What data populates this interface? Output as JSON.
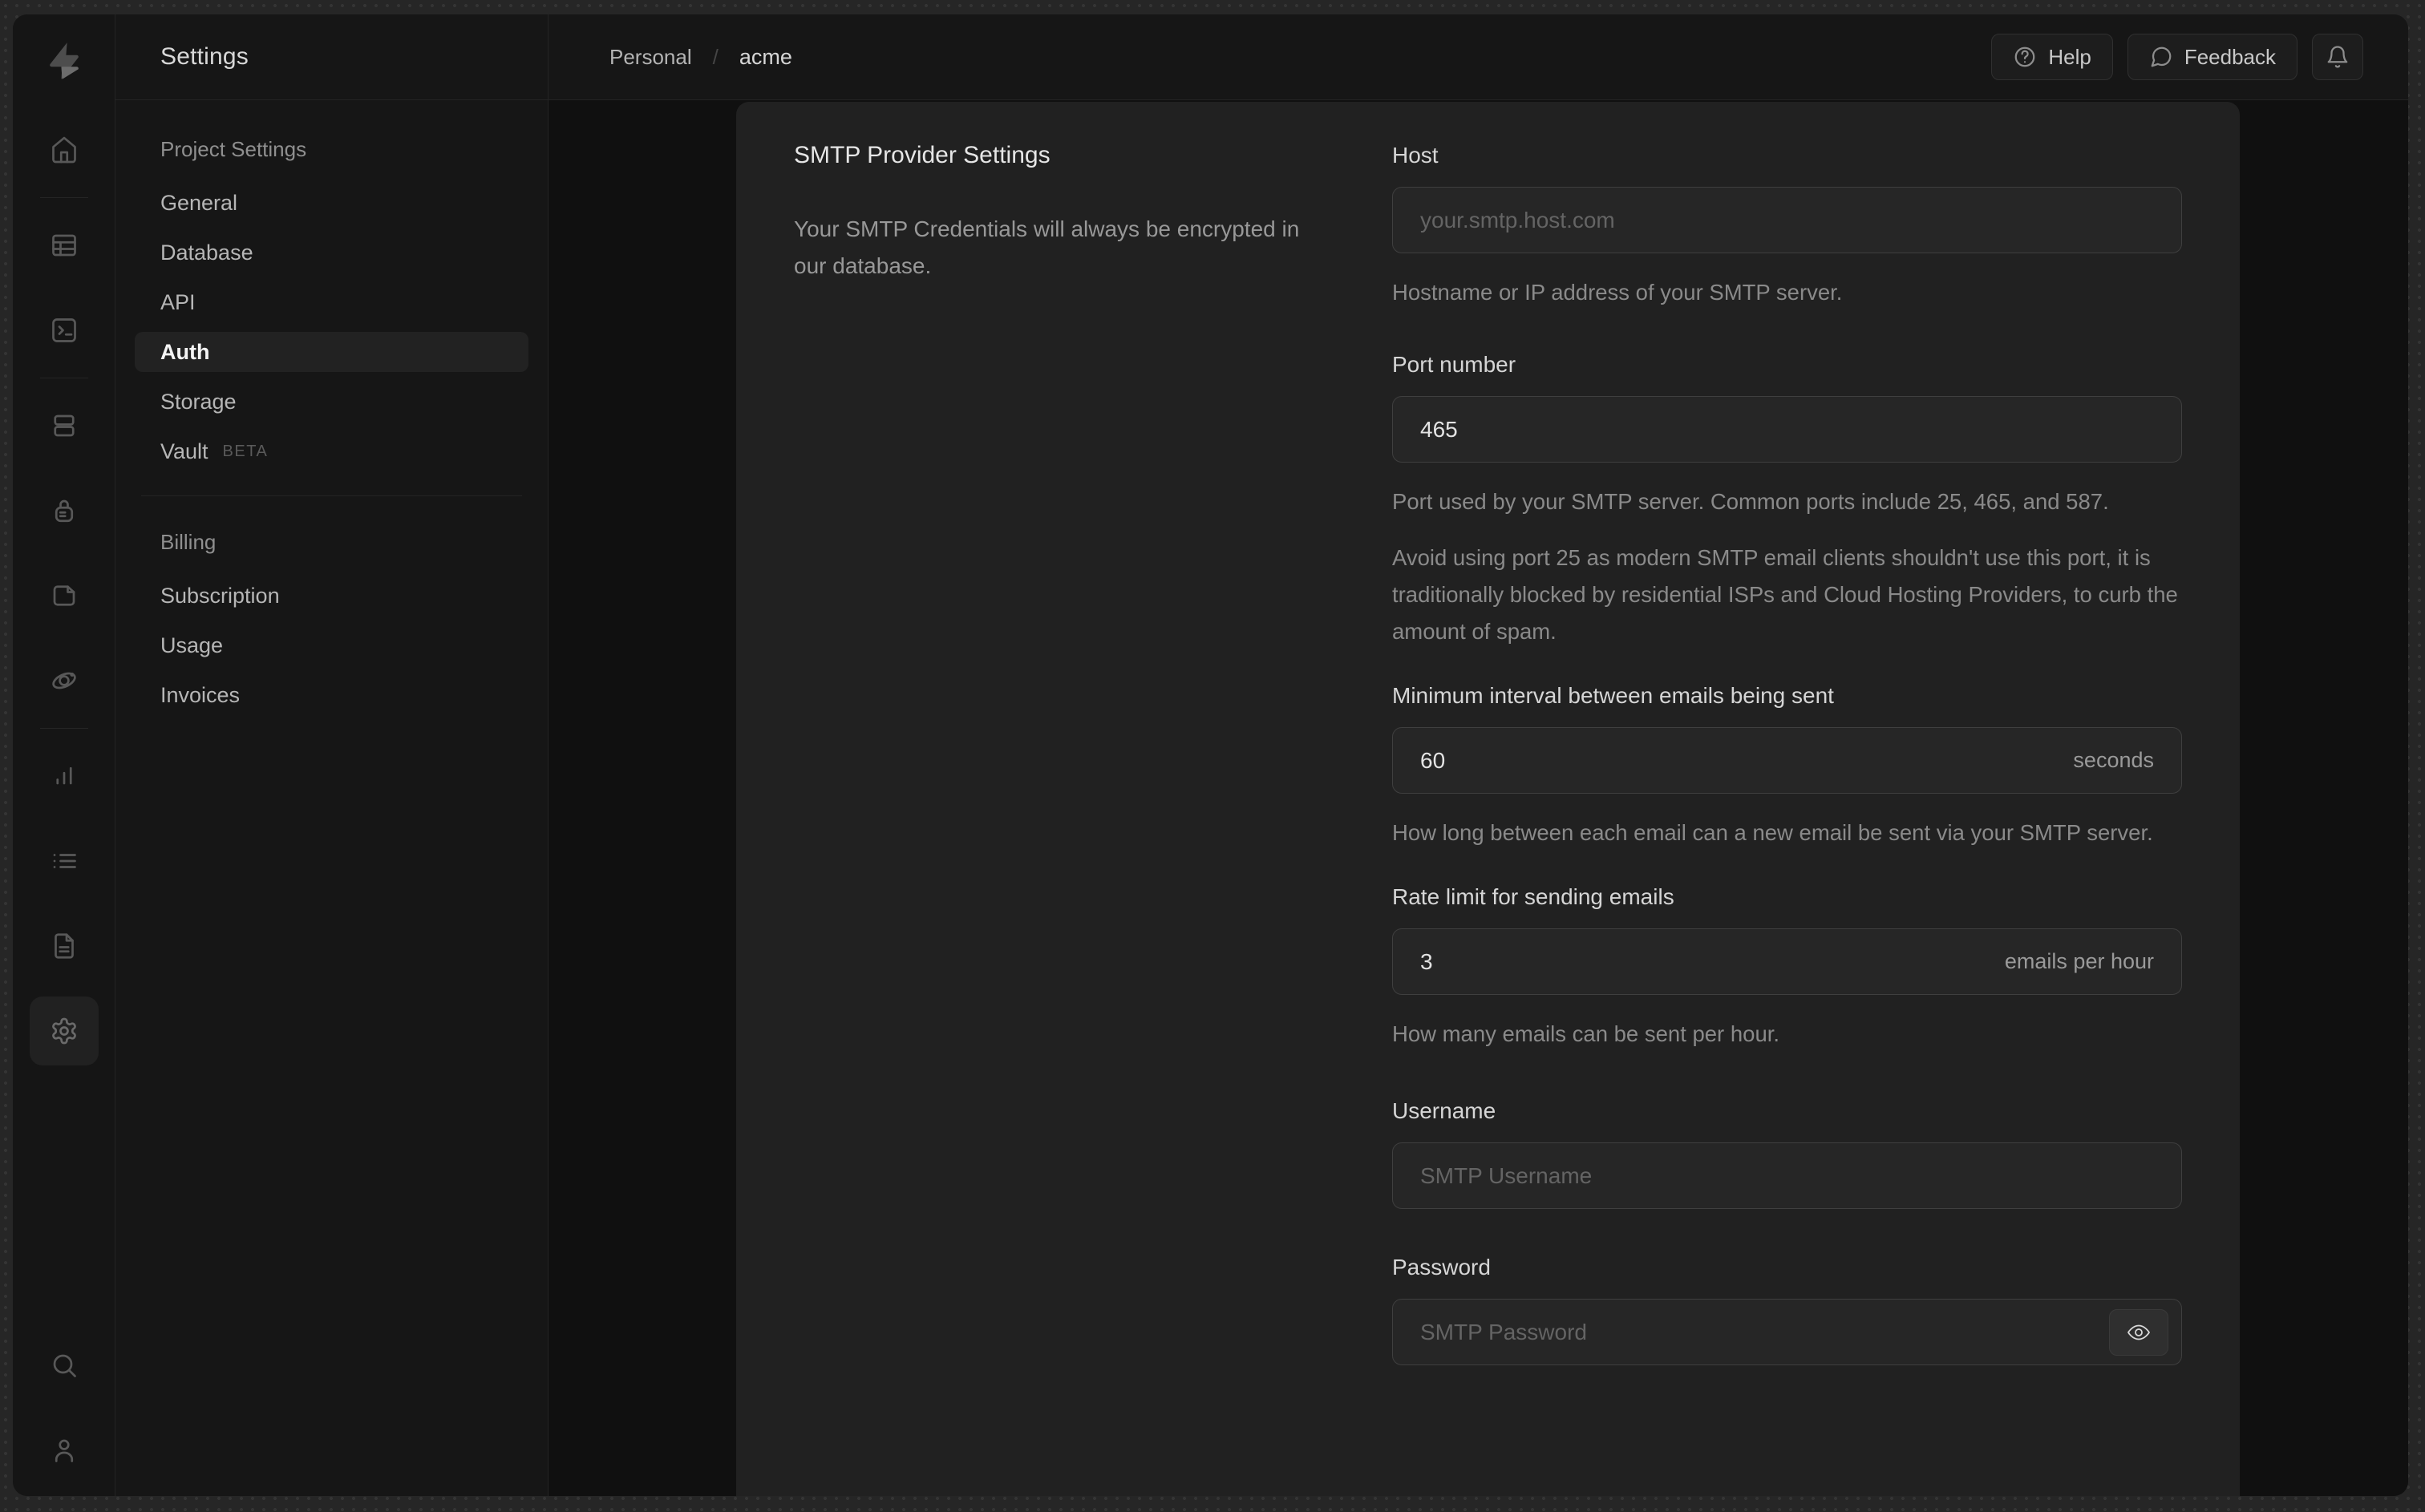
{
  "rail": {
    "icons": [
      "home",
      "table-editor",
      "sql-editor",
      "database",
      "authentication",
      "storage",
      "edge-functions",
      "reports",
      "logs",
      "docs",
      "project-settings",
      "search",
      "account"
    ]
  },
  "settings_nav": {
    "title": "Settings",
    "sections": [
      {
        "heading": "Project Settings",
        "items": [
          {
            "label": "General"
          },
          {
            "label": "Database"
          },
          {
            "label": "API"
          },
          {
            "label": "Auth",
            "active": true
          },
          {
            "label": "Storage"
          },
          {
            "label": "Vault",
            "badge": "BETA"
          }
        ]
      },
      {
        "heading": "Billing",
        "items": [
          {
            "label": "Subscription"
          },
          {
            "label": "Usage"
          },
          {
            "label": "Invoices"
          }
        ]
      }
    ]
  },
  "header": {
    "breadcrumb": {
      "org": "Personal",
      "separator": "/",
      "project": "acme"
    },
    "buttons": {
      "help": "Help",
      "feedback": "Feedback"
    }
  },
  "smtp_panel": {
    "title": "SMTP Provider Settings",
    "description": "Your SMTP Credentials will always be encrypted in our database.",
    "fields": {
      "host": {
        "label": "Host",
        "placeholder": "your.smtp.host.com",
        "help": "Hostname or IP address of your SMTP server."
      },
      "port": {
        "label": "Port number",
        "value": "465",
        "help": "Port used by your SMTP server. Common ports include 25, 465, and 587.",
        "help2": "Avoid using port 25 as modern SMTP email clients shouldn't use this port, it is traditionally blocked by residential ISPs and Cloud Hosting Providers, to curb the amount of spam."
      },
      "interval": {
        "label": "Minimum interval between emails being sent",
        "value": "60",
        "suffix": "seconds",
        "help": "How long between each email can a new email be sent via your SMTP server."
      },
      "rate_limit": {
        "label": "Rate limit for sending emails",
        "value": "3",
        "suffix": "emails per hour",
        "help": "How many emails can be sent per hour."
      },
      "username": {
        "label": "Username",
        "placeholder": "SMTP Username"
      },
      "password": {
        "label": "Password",
        "placeholder": "SMTP Password"
      }
    }
  },
  "colors": {
    "window_bg": "#161616",
    "content_bg": "#101010",
    "card_bg": "#212121",
    "input_bg": "#262626",
    "border": "#242424",
    "input_border": "#3f3f3f",
    "text_primary": "#e6e6e6",
    "text_muted": "#8a8a8a",
    "placeholder": "#646464"
  }
}
